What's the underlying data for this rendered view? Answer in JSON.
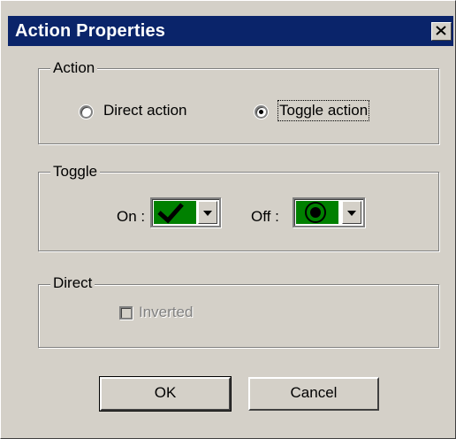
{
  "window": {
    "title": "Action Properties"
  },
  "action_group": {
    "legend": "Action",
    "options": [
      {
        "label": "Direct action",
        "selected": false
      },
      {
        "label": "Toggle action",
        "selected": true
      }
    ]
  },
  "toggle_group": {
    "legend": "Toggle",
    "on_label": "On :",
    "off_label": "Off :",
    "on_icon": "checkmark-icon",
    "off_icon": "target-icon",
    "swatch_color": "#008000"
  },
  "direct_group": {
    "legend": "Direct",
    "inverted_label": "Inverted",
    "inverted_checked": false,
    "enabled": false
  },
  "buttons": {
    "ok": "OK",
    "cancel": "Cancel"
  }
}
